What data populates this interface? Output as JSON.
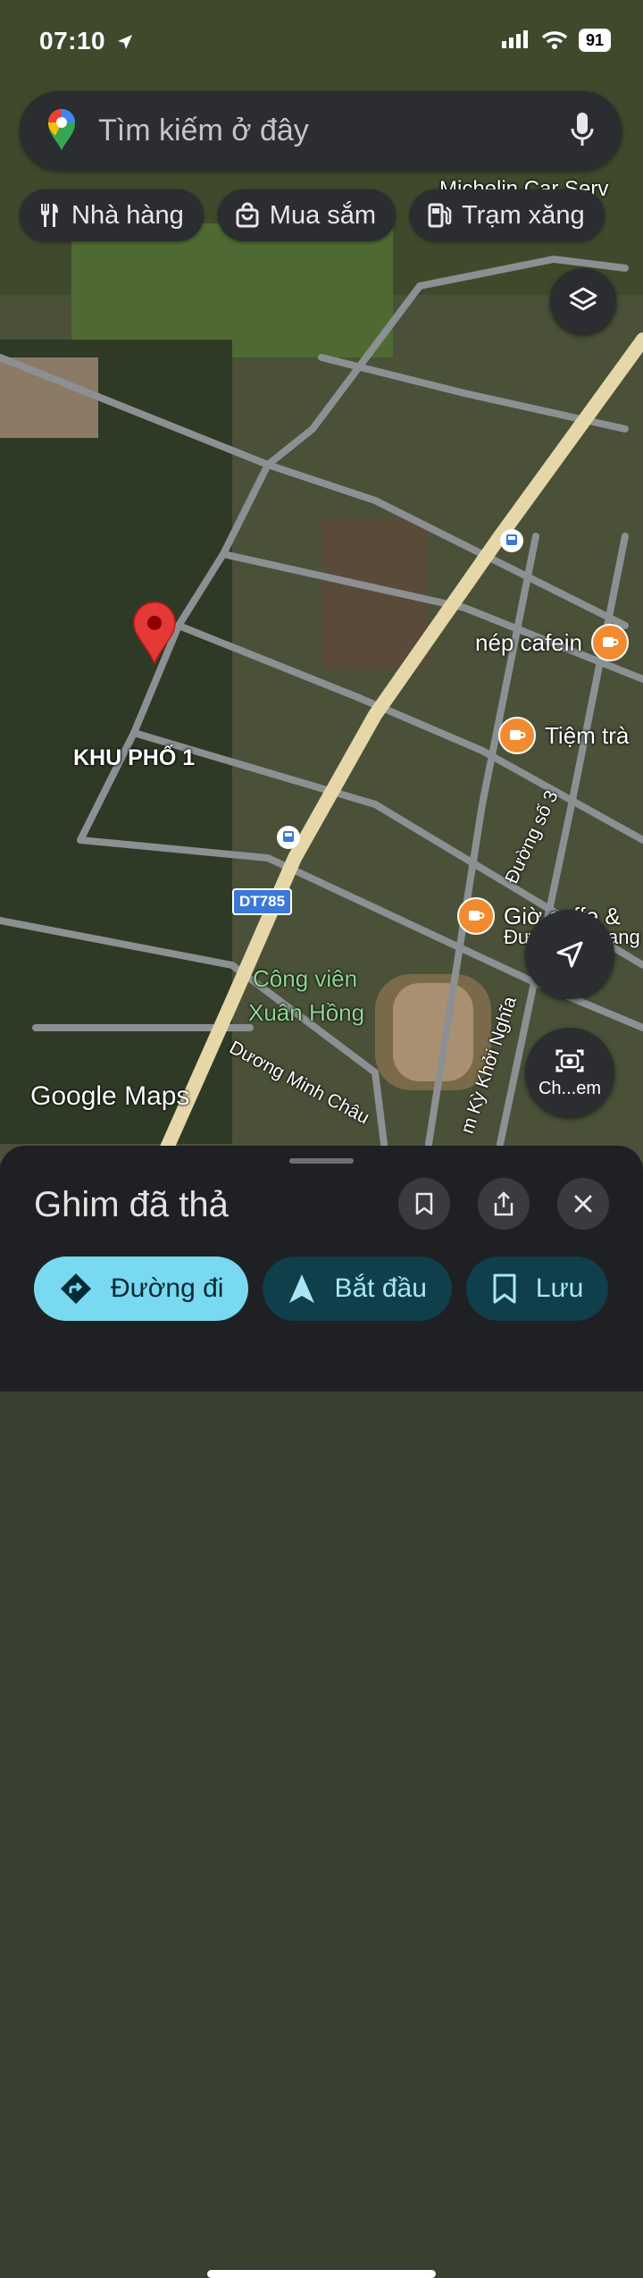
{
  "status": {
    "time": "07:10",
    "battery": "91"
  },
  "search": {
    "placeholder": "Tìm kiếm ở đây"
  },
  "chips": [
    {
      "label": "Nhà hàng",
      "icon": "fork-knife-icon"
    },
    {
      "label": "Mua sắm",
      "icon": "shopping-bag-icon"
    },
    {
      "label": "Trạm xăng",
      "icon": "gas-station-icon"
    }
  ],
  "map": {
    "area_label": "KHU PHỐ 1",
    "park_label_line1": "Công viên",
    "park_label_line2": "Xuân Hồng",
    "road_shield": "DT785",
    "road_duong_so_3": "Đường số 3",
    "road_duong_minh_chau": "Dương Minh Châu",
    "road_ky_khoi_nghia": "m Kỳ Khởi Nghĩa",
    "top_poi": "Michelin Car Serv",
    "poi_1": "nép cafein",
    "poi_2": "Tiệm trà",
    "poi_3": "Giờ coffe &",
    "poi_3_sub": "Đư",
    "poi_3_sub2": "ang",
    "camera_label": "Ch...em",
    "logo": "Google Maps"
  },
  "sheet": {
    "title": "Ghim đã thả",
    "actions": [
      {
        "label": "Đường đi",
        "icon": "directions-icon"
      },
      {
        "label": "Bắt đầu",
        "icon": "navigation-arrow-icon"
      },
      {
        "label": "Lưu",
        "icon": "bookmark-icon"
      }
    ]
  },
  "colors": {
    "sheet_bg": "#1f2023",
    "primary_button": "#78d9f0",
    "pin": "#e53935",
    "poi_orange": "#f28b30"
  }
}
